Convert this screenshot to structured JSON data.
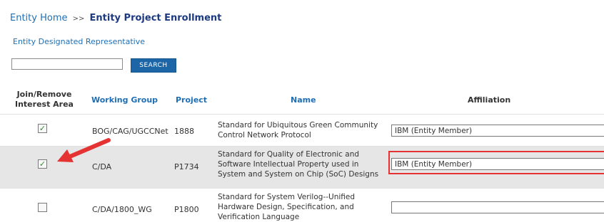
{
  "breadcrumb": {
    "home": "Entity Home",
    "separator": ">>",
    "current": "Entity Project Enrollment"
  },
  "subnav": {
    "label": "Entity Designated Representative"
  },
  "search": {
    "value": "",
    "placeholder": "",
    "button_label": "SEARCH",
    "button_color": "#1c66a7"
  },
  "table": {
    "headers": {
      "join_line1": "Join/Remove",
      "join_line2": "Interest Area",
      "working_group": "Working Group",
      "project": "Project",
      "name": "Name",
      "affiliation": "Affiliation"
    },
    "rows": [
      {
        "checked": true,
        "working_group": "BOG/CAG/UGCCNet",
        "project": "1888",
        "name": "Standard for Ubiquitous Green Community Control Network Protocol",
        "affiliation": "IBM (Entity Member)"
      },
      {
        "checked": true,
        "working_group": "C/DA",
        "project": "P1734",
        "name": "Standard for Quality of Electronic and Software Intellectual Property used in System and System on Chip (SoC) Designs",
        "affiliation": "IBM (Entity Member)"
      },
      {
        "checked": false,
        "working_group": "C/DA/1800_WG",
        "project": "P1800",
        "name": "Standard for System Verilog--Unified Hardware Design, Specification, and Verification Language",
        "affiliation": ""
      }
    ]
  },
  "annotations": {
    "highlight_color": "#e53333",
    "arrow_color": "#e53333",
    "check_color": "#2e8b2e"
  }
}
